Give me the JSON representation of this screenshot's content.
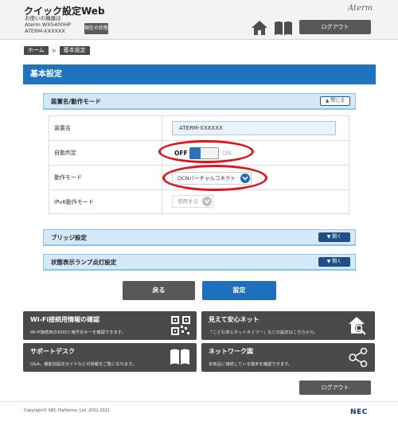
{
  "header": {
    "app_title": "クイック設定Web",
    "device_label": "お使いの機器は",
    "device_model": "Aterm  WX5400HP",
    "device_name": "ATERM-XXXXXX",
    "status_button": "現在の状態",
    "brand": "Aterm",
    "logout": "ログアウト",
    "home_icon": "home-icon",
    "manual_icon": "book-icon"
  },
  "breadcrumb": {
    "home": "ホーム",
    "separator": ">",
    "current": "基本設定"
  },
  "page_title": "基本設定",
  "section_device": {
    "title": "装置名/動作モード",
    "close_button": "閉じる",
    "rows": {
      "device_name": {
        "label": "装置名",
        "value": "ATERM-XXXXXX"
      },
      "auto_detect": {
        "label": "自動判定",
        "off": "OFF",
        "on": "ON"
      },
      "operation_mode": {
        "label": "動作モード",
        "value": "OCNバーチャルコネクト"
      },
      "ipv6_mode": {
        "label": "IPv6動作モード",
        "value": "使用する"
      }
    }
  },
  "section_bridge": {
    "title": "ブリッジ設定",
    "open_button": "開く"
  },
  "section_lamp": {
    "title": "状態表示ランプ点灯設定",
    "open_button": "開く"
  },
  "buttons": {
    "back": "戻る",
    "submit": "設定"
  },
  "tiles": [
    {
      "title": "Wi-Fi接続用情報の確認",
      "desc": "Wi-Fi接続用のSSIDと暗号化キーを確認できます。",
      "icon": "qr-code-icon"
    },
    {
      "title": "見えて安心ネット",
      "desc": "「こども安心ネットタイマー」などの設定はこちらから。",
      "icon": "house-search-icon"
    },
    {
      "title": "サポートデスク",
      "desc": "Q&A、機能別設定ガイドなどの情報をご覧になれます。",
      "icon": "open-book-icon"
    },
    {
      "title": "ネットワーク図",
      "desc": "本商品に接続している端末を確認できます。",
      "icon": "network-share-icon"
    }
  ],
  "footer": {
    "logout": "ログアウト",
    "copyright": "Copyright© NEC Platforms, Ltd. 2001-2021",
    "logo": "NEC"
  },
  "colors": {
    "title_bar": "#1f74c0",
    "section_bg": "#d4e9f8",
    "toggle_knob": "#2a73b8",
    "highlight": "#e0141e",
    "tile_bg": "#4a4a4a"
  }
}
